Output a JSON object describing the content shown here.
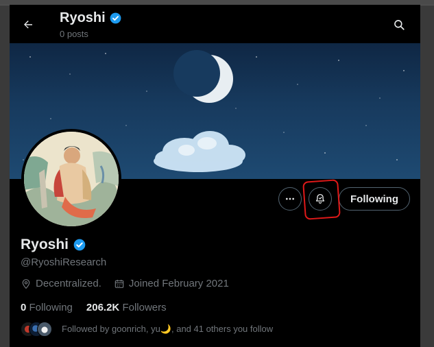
{
  "header": {
    "title": "Ryoshi",
    "posts_count": "0 posts"
  },
  "actions": {
    "more_label": "More",
    "notifications_label": "Notifications",
    "following_label": "Following"
  },
  "profile": {
    "name": "Ryoshi",
    "handle": "@RyoshiResearch",
    "location": "Decentralized.",
    "joined": "Joined February 2021",
    "following_count": "0",
    "following_label": "Following",
    "followers_count": "206.2K",
    "followers_label": "Followers",
    "followed_by": "Followed by goonrich, yu🌙, and 41 others you follow"
  },
  "icons": {
    "back": "arrow-left-icon",
    "search": "search-icon",
    "verified": "verified-badge-icon",
    "more": "more-horizontal-icon",
    "bell": "bell-icon",
    "location": "location-pin-icon",
    "calendar": "calendar-icon"
  },
  "colors": {
    "background": "#000000",
    "text_primary": "#e7e9ea",
    "text_secondary": "#71767b",
    "verified_blue": "#1d9bf0",
    "border": "#536471",
    "highlight_red": "#e01919"
  }
}
